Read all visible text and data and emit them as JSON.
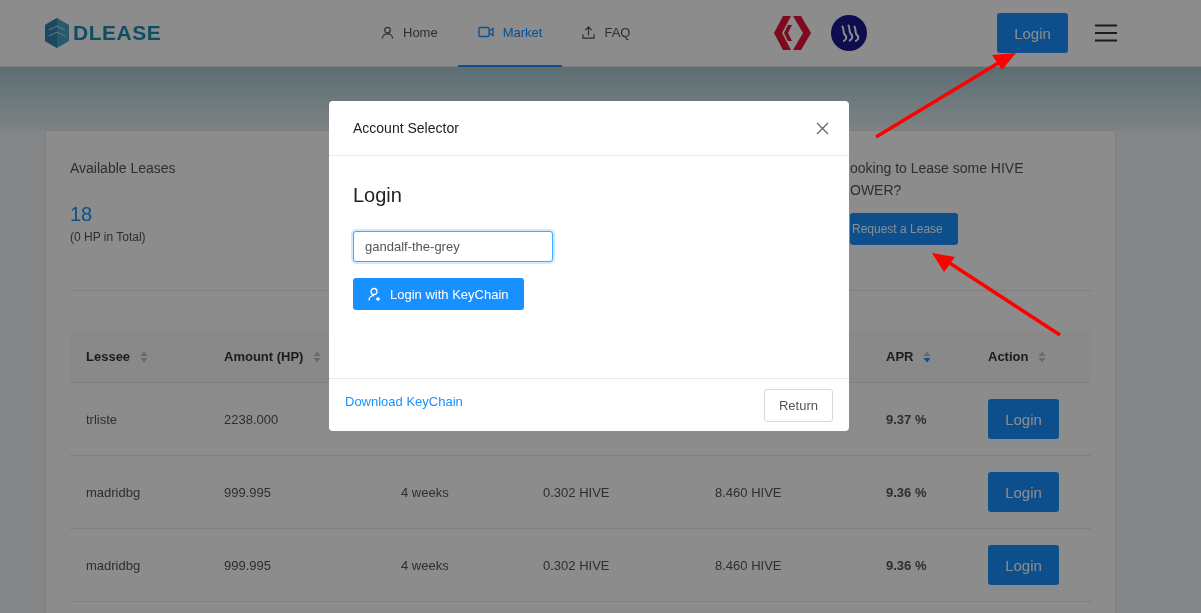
{
  "header": {
    "logo": "DLEASE",
    "nav": [
      {
        "label": "Home",
        "selected": false
      },
      {
        "label": "Market",
        "selected": true
      },
      {
        "label": "FAQ",
        "selected": false
      }
    ],
    "login_button": "Login"
  },
  "stats": [
    {
      "kind": "count",
      "title": "Available Leases",
      "value": "18",
      "note": "(0 HP in Total)"
    },
    {
      "kind": "request",
      "lines": [
        "ooking to Lease some HIVE",
        "OWER?"
      ],
      "button": "Request a Lease"
    }
  ],
  "table": {
    "columns": [
      {
        "kind": "sortable",
        "label": "Lessee",
        "sorted": false
      },
      {
        "kind": "sortable",
        "label": "Amount (HP)",
        "sorted": false
      },
      {
        "kind": "covered"
      },
      {
        "kind": "covered"
      },
      {
        "kind": "covered"
      },
      {
        "kind": "sortable",
        "label": "APR",
        "sorted": true
      },
      {
        "kind": "sortable",
        "label": "Action",
        "sorted": false
      }
    ],
    "rows": [
      {
        "cells": [
          "trliste",
          "2238.000",
          null,
          null,
          null,
          "9.37 %"
        ],
        "action": "Login"
      },
      {
        "cells": [
          "madridbg",
          "999.995",
          "4 weeks",
          "0.302 HIVE",
          "8.460 HIVE",
          "9.36 %"
        ],
        "action": "Login"
      },
      {
        "cells": [
          "madridbg",
          "999.995",
          "4 weeks",
          "0.302 HIVE",
          "8.460 HIVE",
          "9.36 %"
        ],
        "action": "Login"
      }
    ]
  },
  "modal": {
    "title": "Account Selector",
    "heading": "Login",
    "input_value": "gandalf-the-grey",
    "primary_button": "Login with KeyChain",
    "link": "Download KeyChain",
    "return_button": "Return"
  }
}
